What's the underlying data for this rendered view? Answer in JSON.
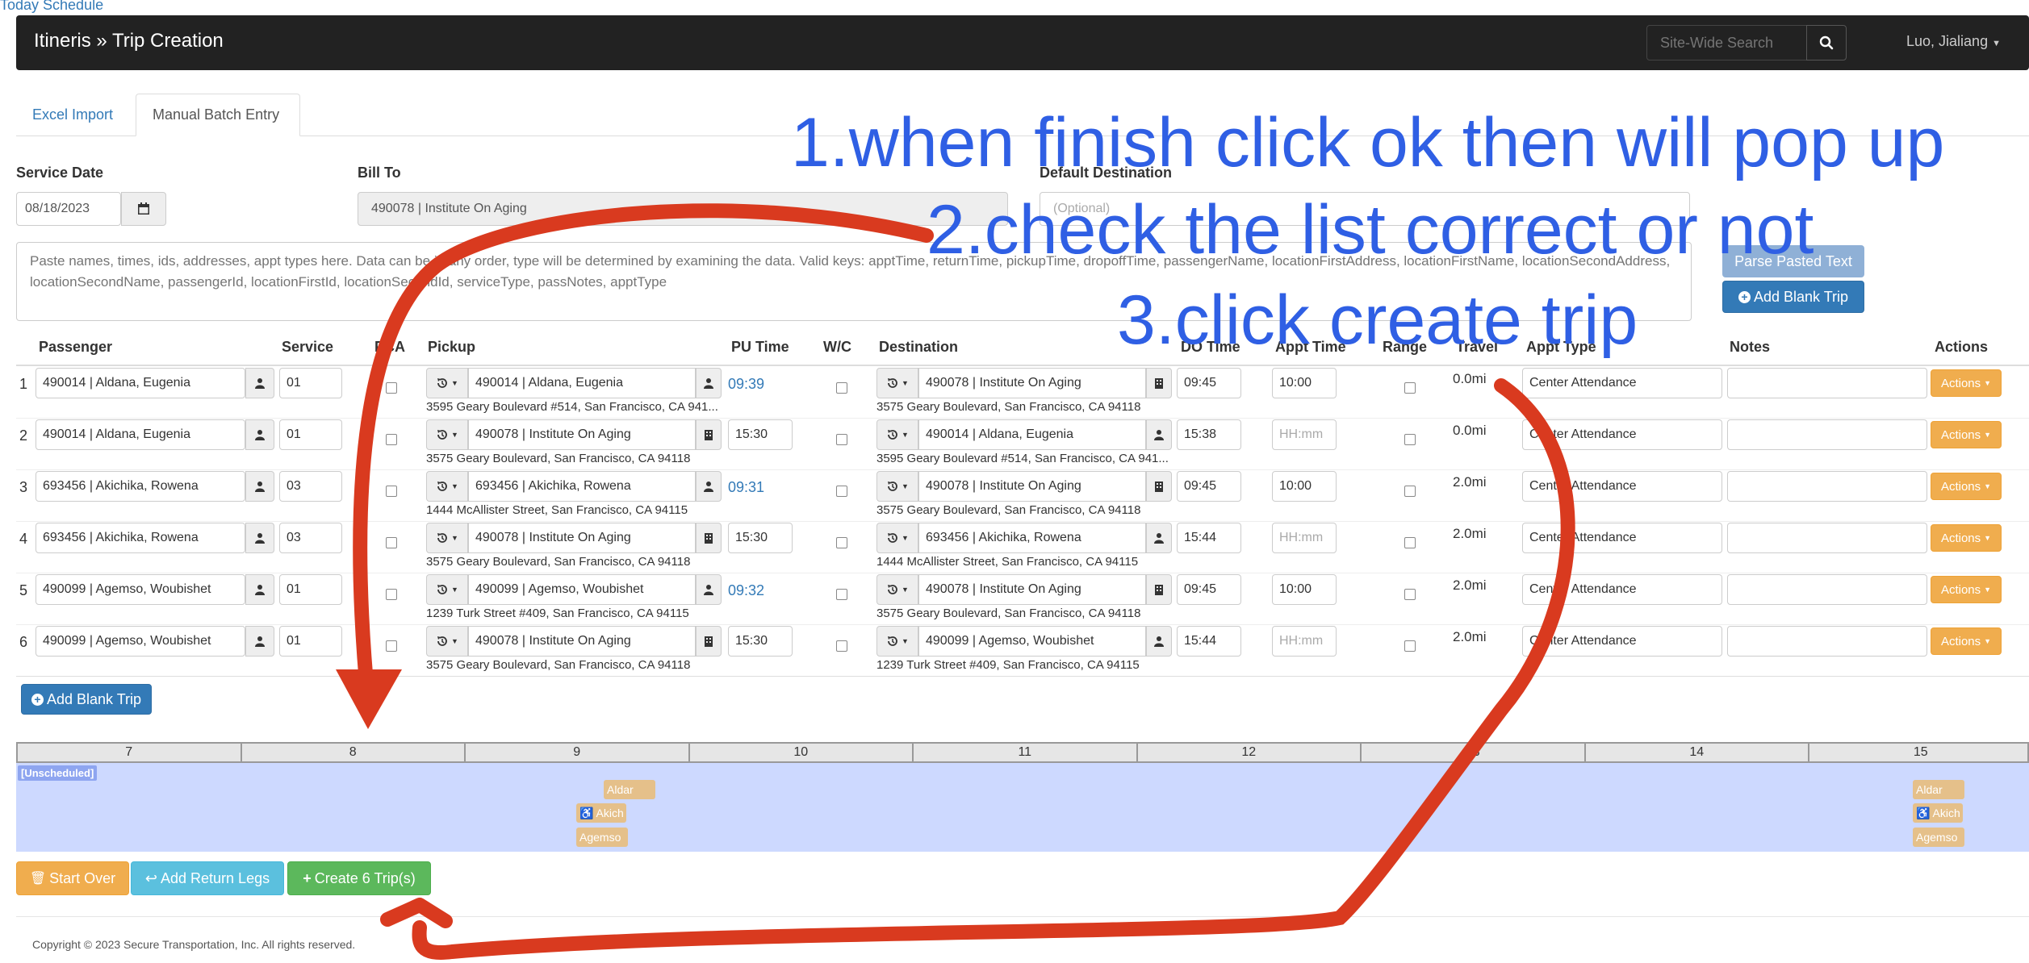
{
  "top_link": "Today Schedule",
  "navbar": {
    "brand": "Itineris » Trip Creation",
    "search_placeholder": "Site-Wide Search",
    "user": "Luo, Jialiang"
  },
  "tabs": [
    {
      "label": "Excel Import"
    },
    {
      "label": "Manual Batch Entry"
    }
  ],
  "form": {
    "service_date_label": "Service Date",
    "service_date_value": "08/18/2023",
    "bill_to_label": "Bill To",
    "bill_to_value": "490078 | Institute On Aging",
    "default_dest_label": "Default Destination",
    "default_dest_placeholder": "(Optional)",
    "paste_placeholder": "Paste names, times, ids, addresses, appt types here. Data can be in any order, type will be determined by examining the data. Valid keys: apptTime, returnTime, pickupTime, dropoffTime, passengerName, locationFirstAddress, locationFirstName, locationSecondAddress, locationSecondName, passengerId, locationFirstId, locationSecondId, serviceType, passNotes, apptType",
    "parse_button": "Parse Pasted Text",
    "add_blank_top": "Add Blank Trip"
  },
  "columns": {
    "passenger": "Passenger",
    "service": "Service",
    "pca": "PCA",
    "pickup": "Pickup",
    "pu_time": "PU Time",
    "wc": "W/C",
    "destination": "Destination",
    "do_time": "DO Time",
    "appt_time": "Appt Time",
    "range": "Range",
    "travel": "Travel",
    "appt_type": "Appt Type",
    "notes": "Notes",
    "actions": "Actions"
  },
  "rows": [
    {
      "num": "1",
      "passenger": "490014 | Aldana, Eugenia",
      "service": "01",
      "pickup": "490014 | Aldana, Eugenia",
      "pickup_addr": "3595 Geary Boulevard #514, San Francisco, CA 941...",
      "pu_time": "09:39",
      "dest": "490078 | Institute On Aging",
      "dest_addr": "3575 Geary Boulevard, San Francisco, CA 94118",
      "do_time": "09:45",
      "appt_time": "10:00",
      "travel": "0.0mi",
      "appt_type": "Center Attendance",
      "actions": "Actions"
    },
    {
      "num": "2",
      "passenger": "490014 | Aldana, Eugenia",
      "service": "01",
      "pickup": "490078 | Institute On Aging",
      "pickup_addr": "3575 Geary Boulevard, San Francisco, CA 94118",
      "pu_time": "15:30",
      "dest": "490014 | Aldana, Eugenia",
      "dest_addr": "3595 Geary Boulevard #514, San Francisco, CA 941...",
      "do_time": "15:38",
      "appt_time": "",
      "travel": "0.0mi",
      "appt_type": "Center Attendance",
      "actions": "Actions"
    },
    {
      "num": "3",
      "passenger": "693456 | Akichika, Rowena",
      "service": "03",
      "pickup": "693456 | Akichika, Rowena",
      "pickup_addr": "1444 McAllister Street, San Francisco, CA 94115",
      "pu_time": "09:31",
      "dest": "490078 | Institute On Aging",
      "dest_addr": "3575 Geary Boulevard, San Francisco, CA 94118",
      "do_time": "09:45",
      "appt_time": "10:00",
      "travel": "2.0mi",
      "appt_type": "Center Attendance",
      "actions": "Actions"
    },
    {
      "num": "4",
      "passenger": "693456 | Akichika, Rowena",
      "service": "03",
      "pickup": "490078 | Institute On Aging",
      "pickup_addr": "3575 Geary Boulevard, San Francisco, CA 94118",
      "pu_time": "15:30",
      "dest": "693456 | Akichika, Rowena",
      "dest_addr": "1444 McAllister Street, San Francisco, CA 94115",
      "do_time": "15:44",
      "appt_time": "",
      "travel": "2.0mi",
      "appt_type": "Center Attendance",
      "actions": "Actions"
    },
    {
      "num": "5",
      "passenger": "490099 | Agemso, Woubishet",
      "service": "01",
      "pickup": "490099 | Agemso, Woubishet",
      "pickup_addr": "1239 Turk Street #409, San Francisco, CA 94115",
      "pu_time": "09:32",
      "dest": "490078 | Institute On Aging",
      "dest_addr": "3575 Geary Boulevard, San Francisco, CA 94118",
      "do_time": "09:45",
      "appt_time": "10:00",
      "travel": "2.0mi",
      "appt_type": "Center Attendance",
      "actions": "Actions"
    },
    {
      "num": "6",
      "passenger": "490099 | Agemso, Woubishet",
      "service": "01",
      "pickup": "490078 | Institute On Aging",
      "pickup_addr": "3575 Geary Boulevard, San Francisco, CA 94118",
      "pu_time": "15:30",
      "dest": "490099 | Agemso, Woubishet",
      "dest_addr": "1239 Turk Street #409, San Francisco, CA 94115",
      "do_time": "15:44",
      "appt_time": "",
      "travel": "2.0mi",
      "appt_type": "Center Attendance",
      "actions": "Actions"
    }
  ],
  "appt_time_placeholder": "HH:mm",
  "add_blank_bottom": "Add Blank Trip",
  "timeline": {
    "hours": [
      "7",
      "8",
      "9",
      "10",
      "11",
      "12",
      "13",
      "14",
      "15"
    ],
    "unscheduled_label": "[Unscheduled]",
    "morning_chips": [
      "Aldar",
      "♿ Akich",
      "Agemso"
    ],
    "afternoon_chips": [
      "Aldar",
      "♿ Akich",
      "Agemso"
    ]
  },
  "bottom_buttons": {
    "start_over": "Start Over",
    "add_return": "Add Return Legs",
    "create": "Create 6 Trip(s)"
  },
  "footer": "Copyright © 2023 Secure Transportation, Inc. All rights reserved.",
  "annotations": {
    "line1": "1.when finish click ok then will pop up",
    "line2": "2.check the list correct or not",
    "line3": "3.click create trip"
  },
  "colors": {
    "navbar": "#222222",
    "link": "#337ab7",
    "primary_button": "#337ab7",
    "parse_button": "#8fb0d6",
    "actions": "#f0ad4e",
    "start_over": "#f0ad4e",
    "add_return": "#5bc0de",
    "create": "#5cb85c",
    "annotation_text": "#2f5fe4",
    "annotation_arrow": "#d93a1f",
    "timeline_bg": "#cdd9ff"
  }
}
